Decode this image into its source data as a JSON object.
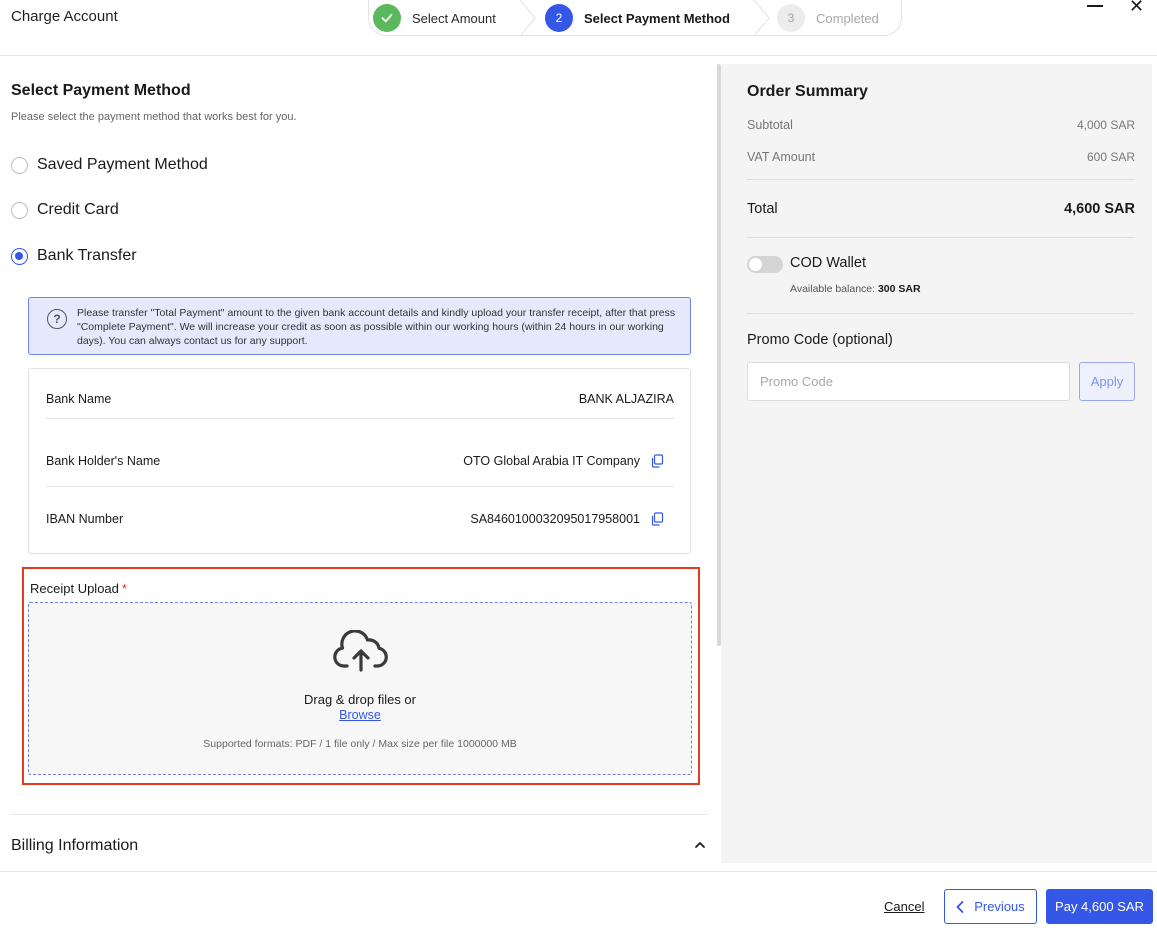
{
  "header": {
    "title": "Charge Account"
  },
  "stepper": {
    "steps": [
      {
        "number": "1",
        "label": "Select Amount",
        "state": "completed"
      },
      {
        "number": "2",
        "label": "Select Payment Method",
        "state": "active"
      },
      {
        "number": "3",
        "label": "Completed",
        "state": "pending"
      }
    ]
  },
  "payment": {
    "title": "Select Payment Method",
    "subtitle": "Please select the payment method that works best for you.",
    "options": [
      {
        "label": "Saved Payment Method",
        "selected": false
      },
      {
        "label": "Credit Card",
        "selected": false
      },
      {
        "label": "Bank Transfer",
        "selected": true
      }
    ],
    "info": "Please transfer \"Total Payment\" amount to the given bank account details and kindly upload your transfer receipt, after that press \"Complete Payment\". We will increase your credit as soon as possible within our working hours (within 24 hours in our working days). You can always contact us for any support."
  },
  "bank": {
    "rows": [
      {
        "key": "Bank Name",
        "value": "BANK ALJAZIRA",
        "copyable": false
      },
      {
        "key": "Bank Holder's Name",
        "value": "OTO Global Arabia IT Company",
        "copyable": true
      },
      {
        "key": "IBAN Number",
        "value": "SA8460100032095017958001",
        "copyable": true
      }
    ]
  },
  "upload": {
    "label": "Receipt Upload",
    "required_mark": "*",
    "drop_text": "Drag & drop files or",
    "browse": "Browse",
    "formats": "Supported formats: PDF / 1 file only / Max size per file 1000000 MB"
  },
  "billing": {
    "title": "Billing Information"
  },
  "summary": {
    "title": "Order Summary",
    "subtotal_label": "Subtotal",
    "subtotal_value": "4,000 SAR",
    "vat_label": "VAT Amount",
    "vat_value": "600 SAR",
    "total_label": "Total",
    "total_value": "4,600 SAR",
    "cod_label": "COD Wallet",
    "cod_enabled": false,
    "balance_label": "Available balance:",
    "balance_value": "300 SAR",
    "promo_title": "Promo Code (optional)",
    "promo_placeholder": "Promo Code",
    "promo_value": "",
    "apply_label": "Apply"
  },
  "footer": {
    "cancel": "Cancel",
    "previous": "Previous",
    "pay": "Pay 4,600 SAR"
  },
  "colors": {
    "primary": "#3457e8",
    "success": "#5cb85c",
    "highlight_border": "#e53a1f",
    "info_bg": "#e6e9fb",
    "summary_bg": "#f4f4f4"
  }
}
